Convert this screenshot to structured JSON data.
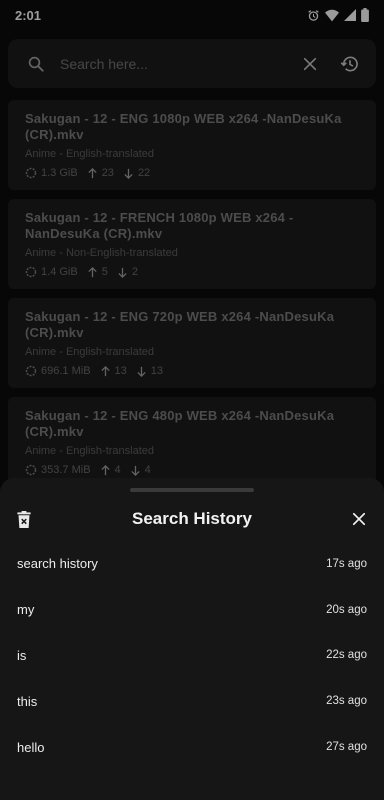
{
  "status_bar": {
    "time": "2:01"
  },
  "search": {
    "placeholder": "Search here..."
  },
  "results": [
    {
      "title": "Sakugan - 12 - ENG 1080p WEB x264 -NanDesuKa (CR).mkv",
      "category": "Anime - English-translated",
      "size": "1.3 GiB",
      "seeders": "23",
      "leechers": "22"
    },
    {
      "title": "Sakugan - 12 - FRENCH 1080p WEB x264 -NanDesuKa (CR).mkv",
      "category": "Anime - Non-English-translated",
      "size": "1.4 GiB",
      "seeders": "5",
      "leechers": "2"
    },
    {
      "title": "Sakugan - 12 - ENG 720p WEB x264 -NanDesuKa (CR).mkv",
      "category": "Anime - English-translated",
      "size": "696.1 MiB",
      "seeders": "13",
      "leechers": "13"
    },
    {
      "title": "Sakugan - 12 - ENG 480p WEB x264 -NanDesuKa (CR).mkv",
      "category": "Anime - English-translated",
      "size": "353.7 MiB",
      "seeders": "4",
      "leechers": "4"
    }
  ],
  "sheet": {
    "title": "Search History",
    "items": [
      {
        "query": "search history",
        "time": "17s ago"
      },
      {
        "query": "my",
        "time": "20s ago"
      },
      {
        "query": "is",
        "time": "22s ago"
      },
      {
        "query": "this",
        "time": "23s ago"
      },
      {
        "query": "hello",
        "time": "27s ago"
      }
    ]
  },
  "icons": {
    "status": [
      "alarm-icon",
      "wifi-icon",
      "signal-icon",
      "battery-icon"
    ],
    "search": "search-icon",
    "clear": "close-icon",
    "history": "history-icon",
    "size": "storage-icon",
    "seeders": "arrow-up-icon",
    "leechers": "arrow-down-icon",
    "delete": "delete-icon",
    "close": "close-icon"
  },
  "colors": {
    "background": "#0c0c0c",
    "card": "#1b1b1b",
    "sheet": "#161616",
    "text": "#ececec"
  }
}
